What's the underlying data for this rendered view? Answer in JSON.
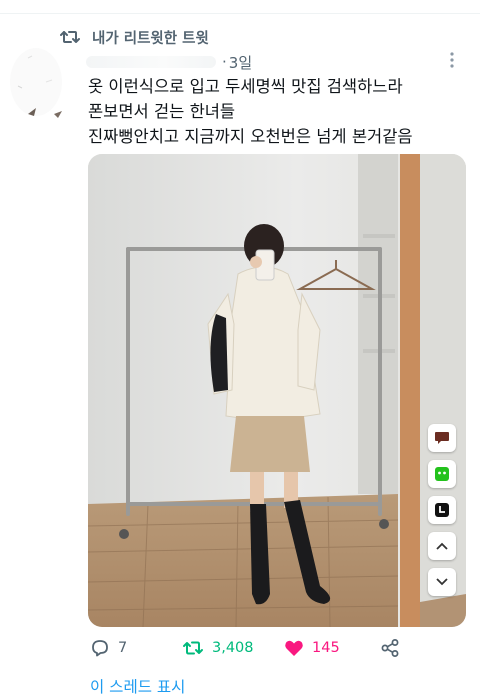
{
  "retweet_header": {
    "label": "내가 리트윗한 트윗",
    "icon": "retweet-icon",
    "color": "#536471"
  },
  "tweet": {
    "time": "3일",
    "separator": "·",
    "lines": [
      "옷 이런식으로 입고 두세명씩 맛집 검색하느라",
      "폰보면서 걷는 한녀들",
      "진짜뻥안치고 지금까지 오천번은 넘게 본거같음"
    ],
    "media": {
      "alt_icon": "photo-outfit-mirror-selfie"
    },
    "overlay_buttons": [
      "comment-icon",
      "chat-icon",
      "timer-icon",
      "chevron-up-icon",
      "chevron-down-icon"
    ]
  },
  "actions": {
    "reply": {
      "count": "7",
      "color": "#536471"
    },
    "retweet": {
      "count": "3,408",
      "color": "#00ba7c"
    },
    "like": {
      "count": "145",
      "color": "#f91880"
    },
    "share": {
      "icon": "share-icon"
    }
  },
  "thread_link": "이 스레드 표시",
  "colors": {
    "link": "#1d9bf0",
    "secondary": "#536471"
  }
}
